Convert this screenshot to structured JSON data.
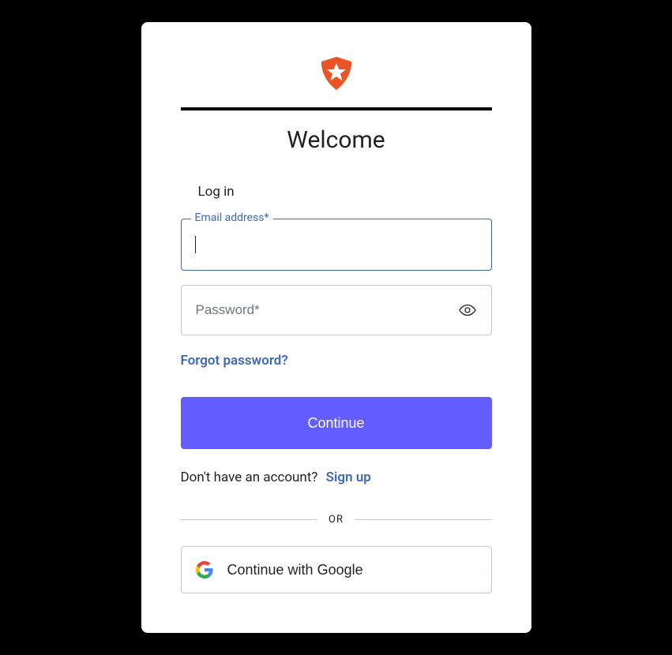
{
  "header": {
    "title": "Welcome"
  },
  "form": {
    "login_label": "Log in",
    "email_label": "Email address*",
    "email_value": "",
    "password_placeholder": "Password*",
    "password_value": "",
    "forgot_link": "Forgot password?",
    "continue_label": "Continue"
  },
  "signup": {
    "prompt": "Don't have an account?",
    "link": "Sign up"
  },
  "divider": {
    "label": "OR"
  },
  "social": {
    "google_label": "Continue with Google"
  }
}
